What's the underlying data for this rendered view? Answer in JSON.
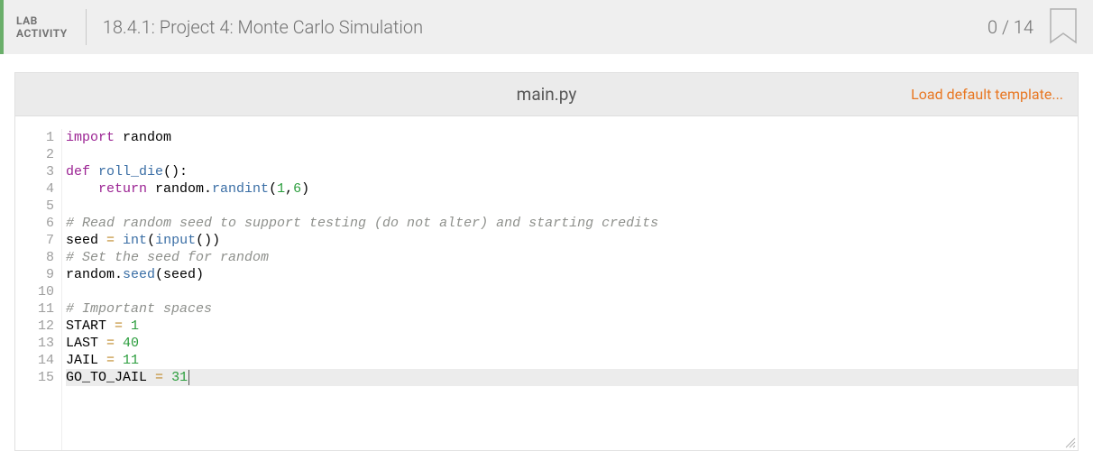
{
  "header": {
    "lab_label_line1": "LAB",
    "lab_label_line2": "ACTIVITY",
    "title": "18.4.1: Project 4: Monte Carlo Simulation",
    "score": "0 / 14"
  },
  "editor": {
    "filename": "main.py",
    "load_template_label": "Load default template..."
  },
  "code": {
    "lines": [
      {
        "n": 1,
        "tokens": [
          [
            "kw",
            "import"
          ],
          [
            "",
            " random"
          ]
        ]
      },
      {
        "n": 2,
        "tokens": []
      },
      {
        "n": 3,
        "tokens": [
          [
            "kw",
            "def"
          ],
          [
            "",
            " "
          ],
          [
            "fn",
            "roll_die"
          ],
          [
            "",
            "():"
          ]
        ]
      },
      {
        "n": 4,
        "tokens": [
          [
            "",
            "    "
          ],
          [
            "kw",
            "return"
          ],
          [
            "",
            " random."
          ],
          [
            "fn",
            "randint"
          ],
          [
            "",
            "("
          ],
          [
            "num",
            "1"
          ],
          [
            "",
            ","
          ],
          [
            "num",
            "6"
          ],
          [
            "",
            ")"
          ]
        ]
      },
      {
        "n": 5,
        "tokens": []
      },
      {
        "n": 6,
        "tokens": [
          [
            "cmt",
            "# Read random seed to support testing (do not alter) and starting credits"
          ]
        ]
      },
      {
        "n": 7,
        "tokens": [
          [
            "",
            "seed "
          ],
          [
            "op",
            "="
          ],
          [
            "",
            " "
          ],
          [
            "fn",
            "int"
          ],
          [
            "",
            "("
          ],
          [
            "fn",
            "input"
          ],
          [
            "",
            "())"
          ]
        ]
      },
      {
        "n": 8,
        "tokens": [
          [
            "cmt",
            "# Set the seed for random"
          ]
        ]
      },
      {
        "n": 9,
        "tokens": [
          [
            "",
            "random."
          ],
          [
            "fn",
            "seed"
          ],
          [
            "",
            "(seed)"
          ]
        ]
      },
      {
        "n": 10,
        "tokens": []
      },
      {
        "n": 11,
        "tokens": [
          [
            "cmt",
            "# Important spaces"
          ]
        ]
      },
      {
        "n": 12,
        "tokens": [
          [
            "",
            "START "
          ],
          [
            "op",
            "="
          ],
          [
            "",
            " "
          ],
          [
            "num",
            "1"
          ]
        ]
      },
      {
        "n": 13,
        "tokens": [
          [
            "",
            "LAST "
          ],
          [
            "op",
            "="
          ],
          [
            "",
            " "
          ],
          [
            "num",
            "40"
          ]
        ]
      },
      {
        "n": 14,
        "tokens": [
          [
            "",
            "JAIL "
          ],
          [
            "op",
            "="
          ],
          [
            "",
            " "
          ],
          [
            "num",
            "11"
          ]
        ]
      },
      {
        "n": 15,
        "tokens": [
          [
            "",
            "GO_TO_JAIL "
          ],
          [
            "op",
            "="
          ],
          [
            "",
            " "
          ],
          [
            "num",
            "31"
          ]
        ],
        "highlighted": true,
        "cursor_after": true
      }
    ]
  }
}
